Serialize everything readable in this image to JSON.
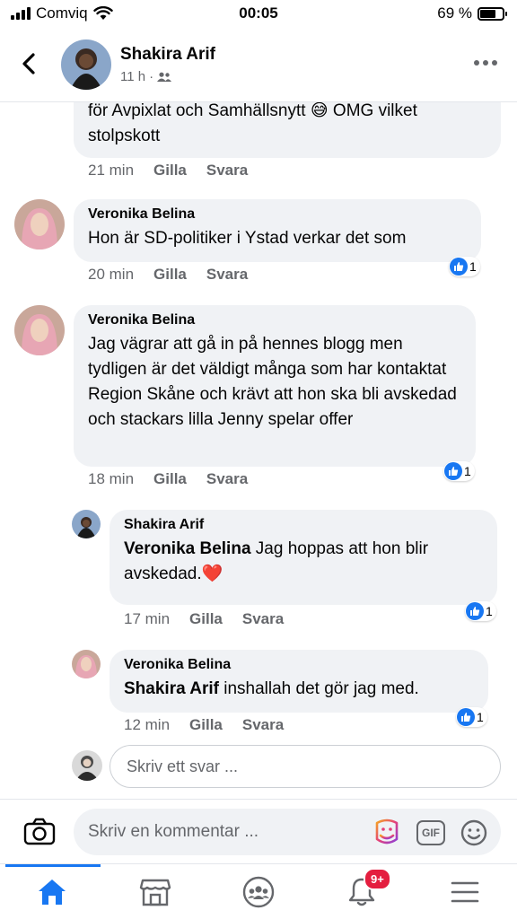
{
  "status_bar": {
    "carrier": "Comviq",
    "time": "00:05",
    "battery": "69 %",
    "battery_level": 0.69
  },
  "header": {
    "name": "Shakira Arif",
    "time": "11 h",
    "separator": "·",
    "audience_icon": "friends-icon"
  },
  "comments": [
    {
      "id": "c0",
      "author": "",
      "text_partial": "för Avpixlat och Samhällsnytt 😅 OMG vilket stolpskott",
      "lines": [
        "för Avpixlat och Samhällsnytt",
        "stolpskott"
      ],
      "emoji": "😅",
      "after_emoji": "OMG vilket",
      "time": "21 min",
      "like": "Gilla",
      "reply": "Svara"
    },
    {
      "id": "c1",
      "author": "Veronika Belina",
      "text": "Hon är SD-politiker i Ystad verkar det som",
      "time": "20 min",
      "like": "Gilla",
      "reply": "Svara",
      "reactions": "1"
    },
    {
      "id": "c2",
      "author": "Veronika Belina",
      "text": "Jag vägrar att gå in på hennes blogg men tydligen är det väldigt många som har kontaktat Region Skåne och krävt att hon ska bli avskedad och stackars lilla Jenny spelar offer",
      "time": "18 min",
      "like": "Gilla",
      "reply": "Svara",
      "reactions": "1"
    },
    {
      "id": "r1",
      "author": "Shakira Arif",
      "mention": "Veronika Belina",
      "text": "Jag hoppas att hon blir avskedad.",
      "emoji": "❤️",
      "time": "17 min",
      "like": "Gilla",
      "reply": "Svara",
      "reactions": "1"
    },
    {
      "id": "r2",
      "author": "Veronika Belina",
      "mention": "Shakira Arif",
      "text": "inshallah det gör jag med.",
      "time": "12 min",
      "like": "Gilla",
      "reply": "Svara",
      "reactions": "1"
    }
  ],
  "reply_input": {
    "placeholder": "Skriv ett svar ..."
  },
  "composer": {
    "placeholder": "Skriv en kommentar ...",
    "gif_label": "GIF"
  },
  "bottom_nav": {
    "items": [
      "home-icon",
      "marketplace-icon",
      "groups-icon",
      "notifications-icon",
      "menu-icon"
    ],
    "notifications_badge": "9+"
  },
  "colors": {
    "brand": "#1877f2",
    "bubble": "#f0f2f5",
    "secondary_text": "#65676b",
    "badge": "#e41e3f"
  }
}
